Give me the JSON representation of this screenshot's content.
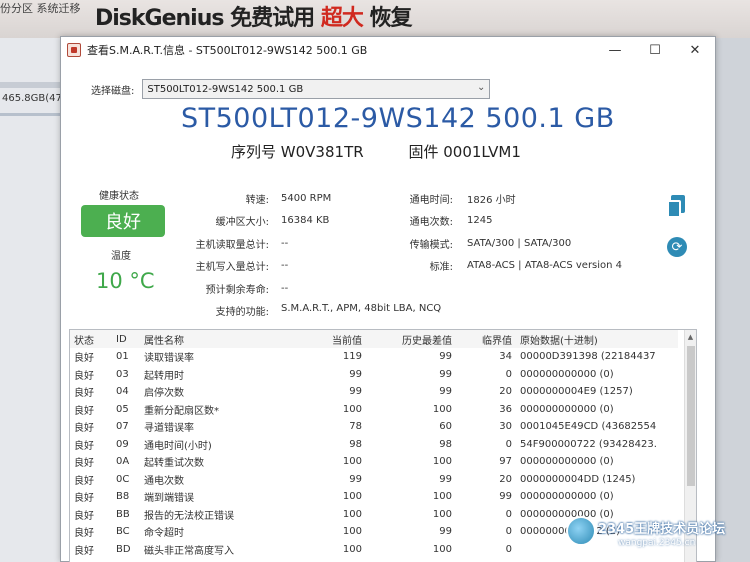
{
  "background": {
    "partition_tabs": "份分区   系统迁移",
    "banner_left": "DiskGenius",
    "banner_mid": "免费试用",
    "banner_red": "超大",
    "banner_right": "恢复",
    "disk_size": "465.8GB(47"
  },
  "window": {
    "title": "查看S.M.A.R.T.信息 - ST500LT012-9WS142 500.1 GB",
    "min_icon": "—",
    "max_icon": "☐",
    "close_icon": "✕"
  },
  "disk_select": {
    "label": "选择磁盘:",
    "value": "ST500LT012-9WS142 500.1 GB"
  },
  "model_name": "ST500LT012-9WS142 500.1 GB",
  "serial_label": "序列号",
  "serial": "W0V381TR",
  "firmware_label": "固件",
  "firmware": "0001LVM1",
  "health": {
    "label": "健康状态",
    "value": "良好",
    "color": "#4caf50"
  },
  "temperature": {
    "label": "温度",
    "value": "10 °C",
    "color": "#3fa84a"
  },
  "info_left": [
    {
      "label": "转速:",
      "value": "5400 RPM"
    },
    {
      "label": "缓冲区大小:",
      "value": "16384 KB"
    },
    {
      "label": "主机读取量总计:",
      "value": "--"
    },
    {
      "label": "主机写入量总计:",
      "value": "--"
    },
    {
      "label": "预计剩余寿命:",
      "value": "--"
    }
  ],
  "info_right": [
    {
      "label": "通电时间:",
      "value": "1826 小时"
    },
    {
      "label": "通电次数:",
      "value": "1245"
    },
    {
      "label": "传输模式:",
      "value": "SATA/300 | SATA/300"
    },
    {
      "label": "标准:",
      "value": "ATA8-ACS | ATA8-ACS version 4"
    }
  ],
  "features": {
    "label": "支持的功能:",
    "value": "S.M.A.R.T., APM, 48bit LBA, NCQ"
  },
  "table": {
    "headers": [
      "状态",
      "ID",
      "属性名称",
      "当前值",
      "历史最差值",
      "临界值",
      "原始数据(十进制)"
    ],
    "rows": [
      [
        "良好",
        "01",
        "读取错误率",
        "119",
        "99",
        "34",
        "00000D391398 (22184437"
      ],
      [
        "良好",
        "03",
        "起转用时",
        "99",
        "99",
        "0",
        "000000000000 (0)"
      ],
      [
        "良好",
        "04",
        "启停次数",
        "99",
        "99",
        "20",
        "0000000004E9 (1257)"
      ],
      [
        "良好",
        "05",
        "重新分配扇区数*",
        "100",
        "100",
        "36",
        "000000000000 (0)"
      ],
      [
        "良好",
        "07",
        "寻道错误率",
        "78",
        "60",
        "30",
        "0001045E49CD (43682554"
      ],
      [
        "良好",
        "09",
        "通电时间(小时)",
        "98",
        "98",
        "0",
        "54F900000722 (93428423."
      ],
      [
        "良好",
        "0A",
        "起转重试次数",
        "100",
        "100",
        "97",
        "000000000000 (0)"
      ],
      [
        "良好",
        "0C",
        "通电次数",
        "99",
        "99",
        "20",
        "0000000004DD (1245)"
      ],
      [
        "良好",
        "B8",
        "端到端错误",
        "100",
        "100",
        "99",
        "000000000000 (0)"
      ],
      [
        "良好",
        "BB",
        "报告的无法校正错误",
        "100",
        "100",
        "0",
        "000000000000 (0)"
      ],
      [
        "良好",
        "BC",
        "命令超时",
        "100",
        "99",
        "0",
        "0000000000002 (2)"
      ],
      [
        "良好",
        "BD",
        "磁头非正常高度写入",
        "100",
        "100",
        "0",
        ""
      ]
    ]
  },
  "watermark": {
    "title": "2345王牌技术员论坛",
    "url": "wangpai.2345.cn"
  }
}
